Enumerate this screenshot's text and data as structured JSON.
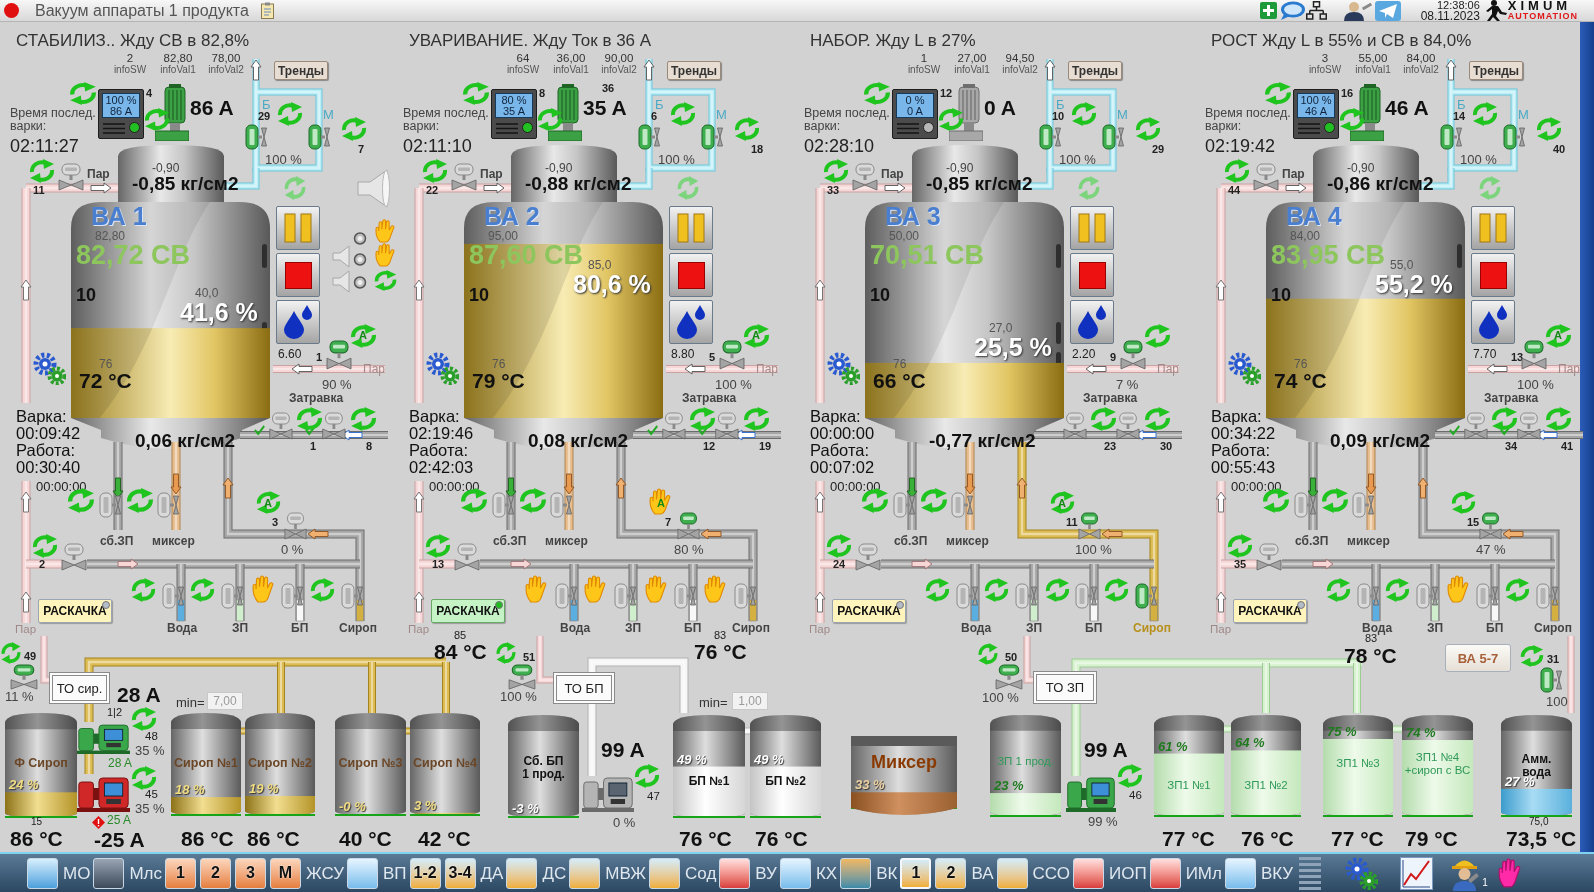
{
  "window": {
    "title": "Вакуум аппараты 1 продукта",
    "time": "12:38:06",
    "date": "08.11.2023",
    "logo_top": "XIMUM",
    "logo_bottom": "AUTOMATION"
  },
  "apparatus": [
    {
      "status": "СТАБИЛИЗ.. Жду СВ в 82,8%",
      "info": [
        {
          "value": "2",
          "label": "infoSW"
        },
        {
          "value": "82,80",
          "label": "infoVal1"
        },
        {
          "value": "78,00",
          "label": "infoVal2"
        }
      ],
      "trends_button": "Тренды",
      "drive": {
        "number": "4",
        "percent": "100 %",
        "current": "86 A",
        "running": true
      },
      "motor_current": "86 A",
      "last_batch_label": "Время послед. варки:",
      "last_batch": "02:11:27",
      "vacuum": {
        "left_label": "Б",
        "left_number": "29",
        "right_label": "М",
        "right_number": "7",
        "percent": "100 %"
      },
      "steam": {
        "number": "11",
        "label": "Пар"
      },
      "vessel": {
        "name": "ВА 1",
        "sv_set": "82,80",
        "sv": "82,72 СВ",
        "number": "10",
        "level_set": "40,0",
        "level_text": "41,6 %",
        "level": 0.416,
        "temp_set": "76",
        "temp": "72 °C",
        "pressure_set": "-0,90",
        "pressure_top": "-0,85 кг/см2",
        "pressure_bottom": "0,06 кг/см2"
      },
      "alarm_panel": true,
      "seed": {
        "value": "6.60",
        "number": "1",
        "percent": "90 %",
        "steam_label": "Пар",
        "label": "Затравка",
        "mode_letter": "A"
      },
      "bottom_valves": {
        "numbers": [
          "1",
          "8"
        ],
        "checked": true
      },
      "timers": {
        "cook_label": "Варка:",
        "cook": "00:09:42",
        "work_label": "Работа:",
        "work": "00:30:40",
        "extra": "00:00:00"
      },
      "outlets": [
        "сб.ЗП",
        "миксер"
      ],
      "discharge": {
        "number": "3",
        "percent": "0 %",
        "open": false,
        "flowing": false,
        "manual": false,
        "mode_letter": "A"
      },
      "inlet_number": "2",
      "rocking_button": {
        "label": "РАСКАЧКА",
        "active": false
      },
      "feeds": [
        {
          "label": "Вода",
          "manual": false,
          "open": false,
          "color": "#5aaee0"
        },
        {
          "label": "ЗП",
          "manual": false,
          "open": false,
          "color": "#cfeecb"
        },
        {
          "label": "БП",
          "manual": true,
          "open": false,
          "color": "#f8f8f8"
        },
        {
          "label": "Сироп",
          "manual": false,
          "open": false,
          "color": "#d4b040"
        }
      ],
      "steam_label_bottom": "Пар"
    },
    {
      "status": "УВАРИВАНИЕ. Жду Ток в 36 А",
      "info": [
        {
          "value": "64",
          "label": "infoSW"
        },
        {
          "value": "36,00",
          "label": "infoVal1"
        },
        {
          "value": "90,00",
          "label": "infoVal2"
        }
      ],
      "trends_button": "Тренды",
      "drive": {
        "number": "8",
        "percent": "80 %",
        "current": "35 A",
        "running": true,
        "current_set": "36"
      },
      "motor_current": "35 A",
      "last_batch_label": "Время послед. варки:",
      "last_batch": "02:11:10",
      "vacuum": {
        "left_label": "Б",
        "left_number": "6",
        "right_label": "М",
        "right_number": "18",
        "percent": "100 %"
      },
      "steam": {
        "number": "22",
        "label": "Пар"
      },
      "vessel": {
        "name": "ВА 2",
        "sv_set": "95,00",
        "sv": "87,60 СВ",
        "number": "10",
        "level_set": "85,0",
        "level_text": "80,6 %",
        "level": 0.806,
        "temp_set": "76",
        "temp": "79 °C",
        "pressure_set": "-0,90",
        "pressure_top": "-0,88 кг/см2",
        "pressure_bottom": "0,08 кг/см2"
      },
      "seed": {
        "value": "8.80",
        "number": "5",
        "percent": "100 %",
        "steam_label": "Пар",
        "label": "Затравка",
        "mode_letter": "A"
      },
      "bottom_valves": {
        "numbers": [
          "12",
          "19"
        ],
        "checked": true
      },
      "timers": {
        "cook_label": "Варка:",
        "cook": "02:19:46",
        "work_label": "Работа:",
        "work": "02:42:03",
        "extra": "00:00:00"
      },
      "outlets": [
        "сб.ЗП",
        "миксер"
      ],
      "discharge": {
        "number": "7",
        "percent": "80 %",
        "open": true,
        "flowing": false,
        "manual": true,
        "mode_letter": "A"
      },
      "inlet_number": "13",
      "rocking_button": {
        "label": "РАСКАЧКА",
        "active": true
      },
      "feeds": [
        {
          "label": "Вода",
          "manual": true,
          "open": false,
          "color": "#5aaee0"
        },
        {
          "label": "ЗП",
          "manual": true,
          "open": false,
          "color": "#cfeecb"
        },
        {
          "label": "БП",
          "manual": true,
          "open": false,
          "color": "#f8f8f8"
        },
        {
          "label": "Сироп",
          "manual": true,
          "open": false,
          "color": "#d4b040"
        }
      ],
      "steam_label_bottom": "Пар"
    },
    {
      "status": "НАБОР. Жду L в 27%",
      "info": [
        {
          "value": "1",
          "label": "infoSW"
        },
        {
          "value": "27,00",
          "label": "infoVal1"
        },
        {
          "value": "94,50",
          "label": "infoVal2"
        }
      ],
      "trends_button": "Тренды",
      "drive": {
        "number": "12",
        "percent": "0 %",
        "current": "0 A",
        "running": false
      },
      "motor_current": "0 A",
      "last_batch_label": "Время послед. варки:",
      "last_batch": "02:28:10",
      "vacuum": {
        "left_label": "Б",
        "left_number": "10",
        "right_label": "М",
        "right_number": "29",
        "percent": "100 %"
      },
      "steam": {
        "number": "33",
        "label": "Пар"
      },
      "vessel": {
        "name": "ВА 3",
        "sv_set": "50,00",
        "sv": "70,51 СВ",
        "number": "10",
        "level_set": "27,0",
        "level_text": "25,5 %",
        "level": 0.255,
        "temp_set": "76",
        "temp": "66 °C",
        "pressure_set": "-0,90",
        "pressure_top": "-0,85 кг/см2",
        "pressure_bottom": "-0,77 кг/см2"
      },
      "seed": {
        "value": "2.20",
        "number": "9",
        "percent": "7 %",
        "steam_label": "Пар",
        "label": "Затравка"
      },
      "bottom_valves": {
        "numbers": [
          "23",
          "30"
        ],
        "checked": false
      },
      "timers": {
        "cook_label": "Варка:",
        "cook": "00:00:00",
        "work_label": "Работа:",
        "work": "00:07:02",
        "extra": "00:00:00"
      },
      "outlets": [
        "сб.ЗП",
        "миксер"
      ],
      "discharge": {
        "number": "11",
        "percent": "100 %",
        "open": true,
        "flowing": true,
        "manual": false,
        "mode_letter": "A"
      },
      "inlet_number": "24",
      "rocking_button": {
        "label": "РАСКАЧКА",
        "active": false
      },
      "feeds": [
        {
          "label": "Вода",
          "manual": false,
          "open": false,
          "color": "#5aaee0"
        },
        {
          "label": "ЗП",
          "manual": false,
          "open": false,
          "color": "#cfeecb"
        },
        {
          "label": "БП",
          "manual": false,
          "open": false,
          "color": "#f8f8f8"
        },
        {
          "label": "Сироп",
          "manual": false,
          "open": true,
          "color": "#d4b040"
        }
      ],
      "steam_label_bottom": "Пар"
    },
    {
      "status": "РОСТ Жду L в 55% и СВ в 84,0%",
      "info": [
        {
          "value": "3",
          "label": "infoSW"
        },
        {
          "value": "55,00",
          "label": "infoVal1"
        },
        {
          "value": "84,00",
          "label": "infoVal2"
        }
      ],
      "trends_button": "Тренды",
      "drive": {
        "number": "16",
        "percent": "100 %",
        "current": "46 A",
        "running": true
      },
      "motor_current": "46 A",
      "last_batch_label": "Время послед. варки:",
      "last_batch": "02:19:42",
      "vacuum": {
        "left_label": "Б",
        "left_number": "14",
        "right_label": "М",
        "right_number": "40",
        "percent": "100 %"
      },
      "steam": {
        "number": "44",
        "label": "Пар"
      },
      "vessel": {
        "name": "ВА 4",
        "sv_set": "84,00",
        "sv": "83,95 СВ",
        "number": "10",
        "level_set": "55,0",
        "level_text": "55,2 %",
        "level": 0.552,
        "temp_set": "76",
        "temp": "74 °C",
        "pressure_set": "-0,90",
        "pressure_top": "-0,86 кг/см2",
        "pressure_bottom": "0,09 кг/см2"
      },
      "seed": {
        "value": "7.70",
        "number": "13",
        "percent": "100 %",
        "steam_label": "Пар",
        "label": "Затравка",
        "mode_letter": "A"
      },
      "bottom_valves": {
        "numbers": [
          "34",
          "41"
        ],
        "checked": true
      },
      "timers": {
        "cook_label": "Варка:",
        "cook": "00:34:22",
        "work_label": "Работа:",
        "work": "00:55:43",
        "extra": "00:00:00"
      },
      "outlets": [
        "сб.ЗП",
        "миксер"
      ],
      "discharge": {
        "number": "15",
        "percent": "47 %",
        "open": true,
        "flowing": false,
        "manual": false
      },
      "inlet_number": "35",
      "rocking_button": {
        "label": "РАСКАЧКА",
        "active": false
      },
      "feeds": [
        {
          "label": "Вода",
          "manual": false,
          "open": false,
          "color": "#5aaee0"
        },
        {
          "label": "ЗП",
          "manual": false,
          "open": false,
          "color": "#cfeecb"
        },
        {
          "label": "БП",
          "manual": true,
          "open": false,
          "color": "#f8f8f8"
        },
        {
          "label": "Сироп",
          "manual": false,
          "open": false,
          "color": "#d4b040"
        }
      ],
      "steam_label_bottom": "Пар"
    }
  ],
  "storage": {
    "lines": [
      {
        "valve_number": "49",
        "valve_percent": "11 %",
        "exchanger": "ТО сир.",
        "current": "28 A",
        "temp_set": "85",
        "temp": "84 °C",
        "min_label": "min=",
        "min_value": "7,00"
      },
      {
        "valve_number": "51",
        "valve_percent": "100 %",
        "exchanger": "ТО БП",
        "current": "99 A",
        "temp_set": "83",
        "temp": "76 °C",
        "min_label": "min=",
        "min_value": "1,00"
      },
      {
        "valve_number": "50",
        "valve_percent": "100 %",
        "exchanger": "ТО ЗП",
        "current": "99 A",
        "temp_set": "83",
        "temp": "78 °C"
      }
    ],
    "pumps": [
      {
        "running": true,
        "fault": false,
        "label": "1|2",
        "number": "48",
        "percent": "35 %",
        "current": "28 A"
      },
      {
        "running": true,
        "fault": true,
        "number": "45",
        "percent": "35 %",
        "current": "25 A",
        "alarm_current": "-25 A"
      },
      {
        "running": false,
        "fault": false,
        "number": "47",
        "percent": "0 %"
      },
      {
        "running": true,
        "fault": false,
        "number": "46",
        "percent": "99 %"
      }
    ],
    "link_button": "ВА 5-7",
    "water_valve": {
      "number": "31",
      "percent": "100"
    },
    "tanks": [
      {
        "kind": "syrup",
        "name": "Ф Сироп",
        "level_text": "24 %",
        "level": 0.24,
        "temp_set": "15",
        "temp": "86 °C"
      },
      {
        "kind": "syrup",
        "name": "Сироп №1",
        "level_text": "18 %",
        "level": 0.18,
        "temp": "86 °C"
      },
      {
        "kind": "syrup",
        "name": "Сироп №2",
        "level_text": "19 %",
        "level": 0.19,
        "temp": "86 °C"
      },
      {
        "kind": "syrup",
        "name": "Сироп №3",
        "level_text": "-0 %",
        "level": 0,
        "temp": "40 °C"
      },
      {
        "kind": "syrup",
        "name": "Сироп №4",
        "level_text": "3 %",
        "level": 0.03,
        "temp": "42 °C"
      },
      {
        "kind": "bp",
        "name": "Сб. БП\n1 прод.",
        "level_text": "-3 %",
        "level": 0
      },
      {
        "kind": "bp",
        "name": "БП №1",
        "level_text": "49 %",
        "level": 0.49,
        "temp": "76 °C"
      },
      {
        "kind": "bp",
        "name": "БП №2",
        "level_text": "49 %",
        "level": 0.49,
        "temp": "76 °C"
      },
      {
        "kind": "mixer",
        "name": "Миксер",
        "level_text": "33 %",
        "level": 0.33
      },
      {
        "kind": "zp",
        "name": "ЗП 1 прод.",
        "level_text": "23 %",
        "level": 0.23
      },
      {
        "kind": "zp",
        "name": "ЗП1 №1",
        "level_text": "61 %",
        "level": 0.61,
        "temp": "77 °C"
      },
      {
        "kind": "zp",
        "name": "ЗП1 №2",
        "level_text": "64 %",
        "level": 0.64,
        "temp": "76 °C"
      },
      {
        "kind": "zp",
        "name": "ЗП1 №3",
        "level_text": "75 %",
        "level": 0.75,
        "temp": "77 °C"
      },
      {
        "kind": "zp",
        "name": "ЗП1 №4\n+сироп с ВС",
        "level_text": "74 %",
        "level": 0.74,
        "temp": "79 °C"
      },
      {
        "kind": "water",
        "name": "Амм.\nвода",
        "level_text": "27 %",
        "level": 0.27,
        "temp_set": "75,0",
        "temp": "73,5 °C"
      }
    ]
  },
  "taskbar": {
    "groups": [
      {
        "tiles": [
          {
            "kind": "water",
            "selected": false
          }
        ],
        "label": "МО"
      },
      {
        "tiles": [
          {
            "kind": "dust",
            "selected": false
          }
        ],
        "label": "Млс"
      },
      {
        "tiles": [
          {
            "kind": "fire",
            "text": "1",
            "selected": false
          },
          {
            "kind": "fire",
            "text": "2",
            "selected": false
          },
          {
            "kind": "fire",
            "text": "3",
            "selected": false
          },
          {
            "kind": "fire",
            "text": "М",
            "selected": false
          }
        ],
        "label": "ЖСУ"
      },
      {
        "tiles": [
          {
            "kind": "sky",
            "selected": false
          }
        ],
        "label": "ВП"
      },
      {
        "tiles": [
          {
            "kind": "sand",
            "text": "1-2",
            "selected": false
          },
          {
            "kind": "sand",
            "text": "3-4",
            "selected": false
          }
        ],
        "label": "ДА"
      },
      {
        "tiles": [
          {
            "kind": "sand",
            "selected": false
          }
        ],
        "label": "ДС"
      },
      {
        "tiles": [
          {
            "kind": "sand",
            "selected": false
          }
        ],
        "label": "МВЖ"
      },
      {
        "tiles": [
          {
            "kind": "sand",
            "selected": false
          }
        ],
        "label": "Сод"
      },
      {
        "tiles": [
          {
            "kind": "heat",
            "selected": false
          }
        ],
        "label": "ВУ"
      },
      {
        "tiles": [
          {
            "kind": "sky",
            "selected": false
          }
        ],
        "label": "КХ"
      },
      {
        "tiles": [
          {
            "kind": "earth",
            "selected": false
          }
        ],
        "label": "ВК"
      },
      {
        "tiles": [
          {
            "kind": "sand",
            "text": "1",
            "selected": true
          },
          {
            "kind": "sand",
            "text": "2",
            "selected": false
          }
        ],
        "label": "ВА"
      },
      {
        "tiles": [
          {
            "kind": "sand",
            "selected": false
          }
        ],
        "label": "ССО"
      },
      {
        "tiles": [
          {
            "kind": "heat",
            "selected": false
          }
        ],
        "label": "ИОП"
      },
      {
        "tiles": [
          {
            "kind": "heat",
            "selected": false
          }
        ],
        "label": "ИМл"
      },
      {
        "tiles": [
          {
            "kind": "sky",
            "selected": false
          }
        ],
        "label": "ВКУ"
      }
    ],
    "user_badge": "1"
  }
}
